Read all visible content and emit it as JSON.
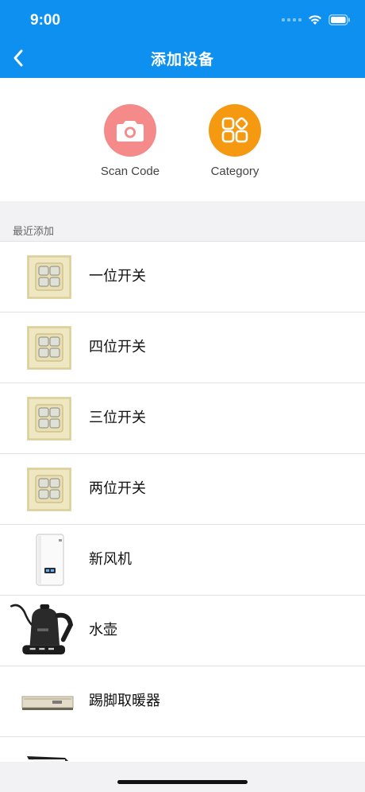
{
  "status": {
    "time": "9:00"
  },
  "nav": {
    "title": "添加设备"
  },
  "actions": [
    {
      "label": "Scan Code",
      "icon": "camera-icon",
      "color": "#f48a8a"
    },
    {
      "label": "Category",
      "icon": "category-grid-icon",
      "color": "#f59a10"
    }
  ],
  "recent": {
    "title": "最近添加",
    "items": [
      {
        "name": "一位开关",
        "icon": "switch-panel-icon"
      },
      {
        "name": "四位开关",
        "icon": "switch-panel-icon"
      },
      {
        "name": "三位开关",
        "icon": "switch-panel-icon"
      },
      {
        "name": "两位开关",
        "icon": "switch-panel-icon"
      },
      {
        "name": "新风机",
        "icon": "air-unit-icon"
      },
      {
        "name": "水壶",
        "icon": "kettle-icon"
      },
      {
        "name": "踢脚取暖器",
        "icon": "heater-icon"
      }
    ]
  },
  "colors": {
    "header": "#0e90f1",
    "background": "#f2f2f5"
  }
}
